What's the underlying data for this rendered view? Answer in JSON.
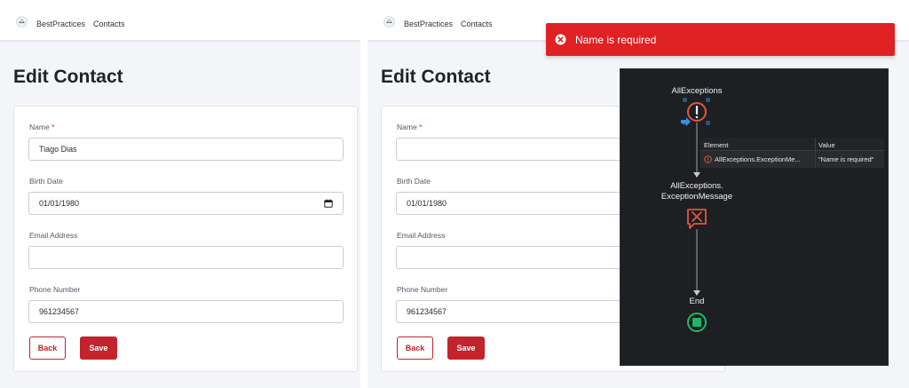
{
  "app": {
    "name": "BestPractices",
    "nav_contacts": "Contacts"
  },
  "page": {
    "title": "Edit Contact"
  },
  "form": {
    "name_label": "Name",
    "required_mark": "*",
    "birth_label": "Birth Date",
    "email_label": "Email Address",
    "phone_label": "Phone Number",
    "back_label": "Back",
    "save_label": "Save"
  },
  "left_values": {
    "name": "Tiago Dias",
    "birth": "01/01/1980",
    "email": "",
    "phone": "961234567"
  },
  "right_values": {
    "name": "",
    "birth": "01/01/1980",
    "email": "",
    "phone": "961234567"
  },
  "toast": {
    "message": "Name is required",
    "color": "#df2124"
  },
  "debugger": {
    "start_node": "AllExceptions",
    "action_node_line1": "AllExceptions.",
    "action_node_line2": "ExceptionMessage",
    "end_node": "End",
    "watch": {
      "col_element": "Element",
      "col_value": "Value",
      "row_element": "AllExceptions.ExceptionMe...",
      "row_value": "\"Name is required\""
    }
  },
  "colors": {
    "accent": "#c2232c",
    "error_icon": "#e2553d",
    "end_icon": "#1db76a"
  }
}
